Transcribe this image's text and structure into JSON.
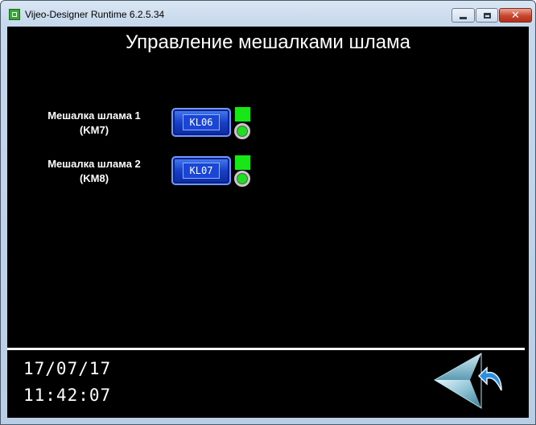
{
  "window": {
    "title": "Vijeo-Designer Runtime 6.2.5.34"
  },
  "screen": {
    "title": "Управление мешалками шлама"
  },
  "mixers": [
    {
      "label_line1": "Мешалка шлама 1",
      "label_line2": "(KM7)",
      "button": "KL06",
      "status_color": "#17e617"
    },
    {
      "label_line1": "Мешалка шлама 2",
      "label_line2": "(KM8)",
      "button": "KL07",
      "status_color": "#17e617"
    }
  ],
  "footer": {
    "date": "17/07/17",
    "time": "11:42:07"
  },
  "icons": {
    "back": "back-arrow-icon"
  }
}
